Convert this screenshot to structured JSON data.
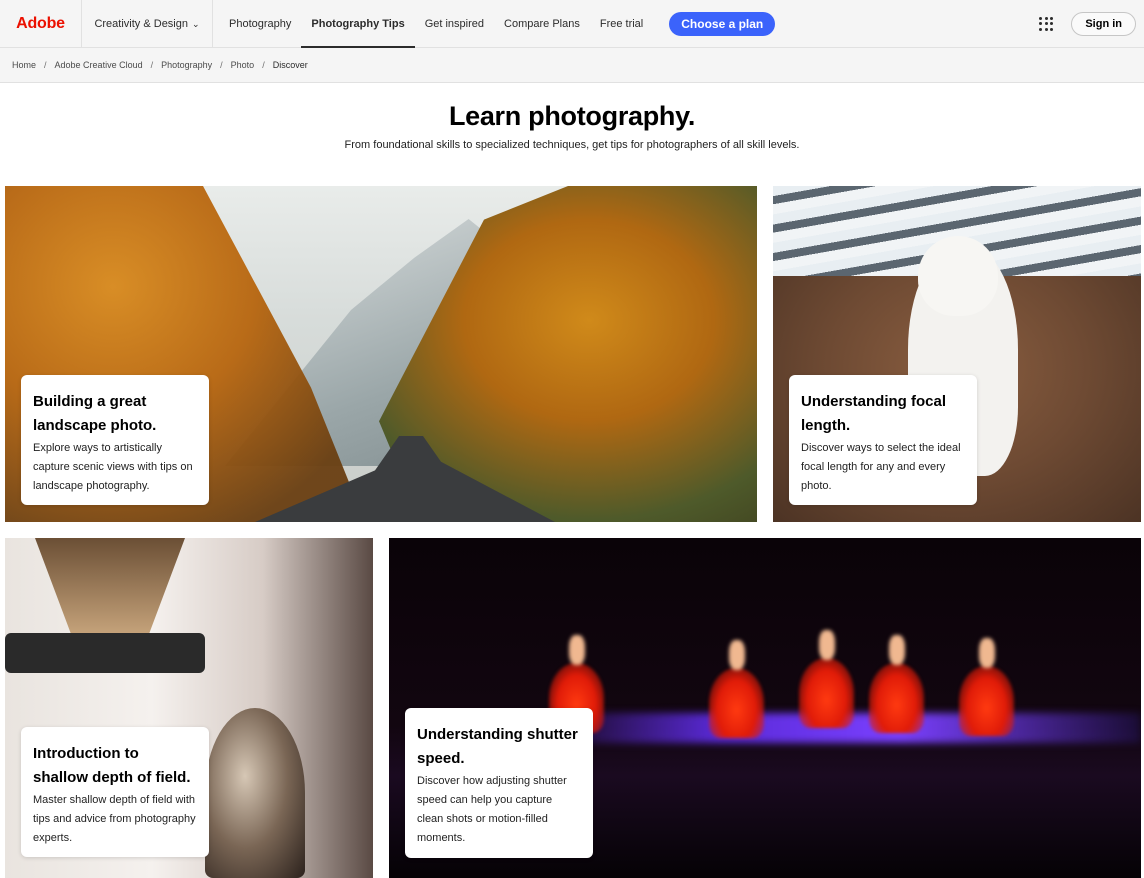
{
  "nav": {
    "brand": "Adobe",
    "category": "Creativity & Design",
    "links": [
      "Photography",
      "Photography Tips",
      "Get inspired",
      "Compare Plans",
      "Free trial"
    ],
    "active_link": "Photography Tips",
    "cta": "Choose a plan",
    "sign_in": "Sign in",
    "apps_icon": "apps-grid-icon"
  },
  "breadcrumb": [
    "Home",
    "Adobe Creative Cloud",
    "Photography",
    "Photo",
    "Discover"
  ],
  "hero": {
    "title": "Learn photography.",
    "subtitle": "From foundational skills to specialized techniques, get tips for photographers of all skill levels."
  },
  "cards": [
    {
      "title": "Building a great landscape photo.",
      "desc": "Explore ways to artistically capture scenic views with tips on landscape photography."
    },
    {
      "title": "Understanding focal length.",
      "desc": "Discover ways to select the ideal focal length for any and every photo."
    },
    {
      "title": "Introduction to shallow depth of field.",
      "desc": "Master shallow depth of field with tips and advice from photography experts."
    },
    {
      "title": "Understanding shutter speed.",
      "desc": "Discover how adjusting shutter speed can help you capture clean shots or motion-filled moments."
    }
  ],
  "colors": {
    "brand": "#eb1000",
    "cta": "#3b63fb"
  }
}
